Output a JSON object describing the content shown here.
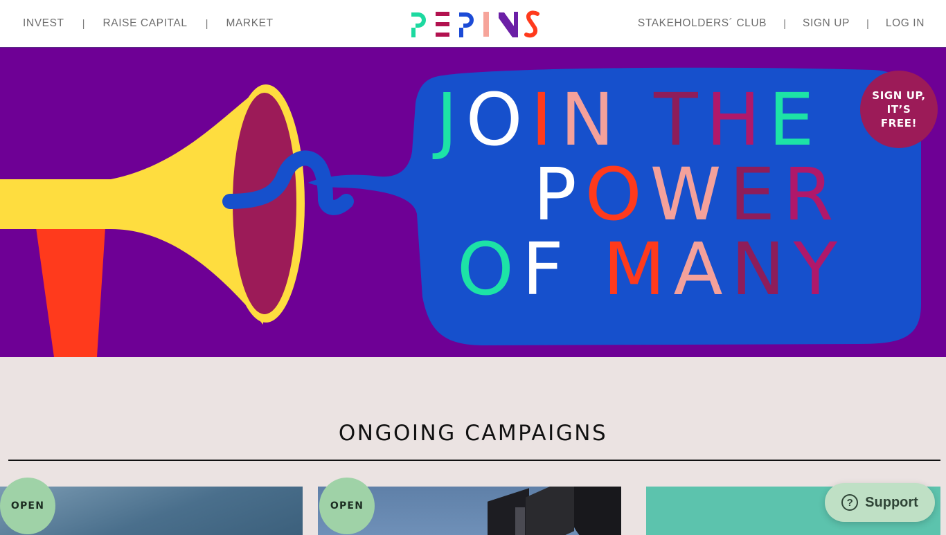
{
  "nav_left": [
    {
      "label": "INVEST"
    },
    {
      "label": "RAISE CAPITAL"
    },
    {
      "label": "MARKET"
    }
  ],
  "nav_right": [
    {
      "label": "STAKEHOLDERS´ CLUB"
    },
    {
      "label": "SIGN UP"
    },
    {
      "label": "LOG IN"
    }
  ],
  "nav_separator": "|",
  "logo": {
    "text": "PEPINS",
    "colors": [
      "#1dd9a0",
      "#b2124f",
      "#1c4bd6",
      "#f6a49a",
      "#6b1fa6",
      "#ff3a1c"
    ]
  },
  "hero": {
    "lines": [
      "JOIN THE",
      "POWER",
      "OF MANY"
    ],
    "letter_colors": [
      "#1de3a6",
      "#ffffff",
      "#ff3a1c",
      "#f4a19b",
      "#8e1d5a",
      "#b0186a"
    ],
    "background": "#6e0095",
    "bubble_color": "#1650cc",
    "horn_color": "#fedd3f",
    "signup_badge": "SIGN UP, IT’S FREE!"
  },
  "campaigns": {
    "title": "ONGOING CAMPAIGNS",
    "cards": [
      {
        "status": "OPEN"
      },
      {
        "status": "OPEN"
      },
      {
        "status": ""
      }
    ]
  },
  "support": {
    "label": "Support",
    "icon": "question-circle-icon"
  }
}
